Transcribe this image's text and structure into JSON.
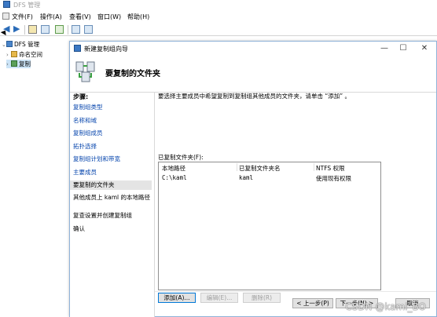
{
  "app": {
    "title": "DFS 管理"
  },
  "menu": [
    "文件(F)",
    "操作(A)",
    "查看(V)",
    "窗口(W)",
    "帮助(H)"
  ],
  "tree": {
    "root": "DFS 管理",
    "namespace": "命名空间",
    "replication": "复制"
  },
  "wizard": {
    "title": "新建复制组向导",
    "header_title": "要复制的文件夹",
    "steps_label": "步骤:",
    "steps": [
      "复制组类型",
      "名称和域",
      "复制组成员",
      "拓扑选择",
      "复制组计划和带宽",
      "主要成员",
      "要复制的文件夹",
      "其他成员上 kaml 的本地路径",
      "复查设置并创建复制组",
      "确认"
    ],
    "current_step_index": 6,
    "instruction": "要选择主要成员中希望复制到复制组其他成员的文件夹，请单击 “添加” 。",
    "list_label": "已复制文件夹(F):",
    "columns": [
      "本地路径",
      "已复制文件夹名",
      "NTFS 权限"
    ],
    "rows": [
      {
        "path": "C:\\kaml",
        "name": "kaml",
        "perm": "使用现有权限"
      }
    ],
    "buttons": {
      "add": "添加(A)...",
      "edit": "编辑(E)...",
      "delete": "删除(R)",
      "back": "< 上一步(P)",
      "next": "下一步(N) >",
      "cancel": "取消"
    }
  },
  "watermark": "CSDN @kaml_BO"
}
